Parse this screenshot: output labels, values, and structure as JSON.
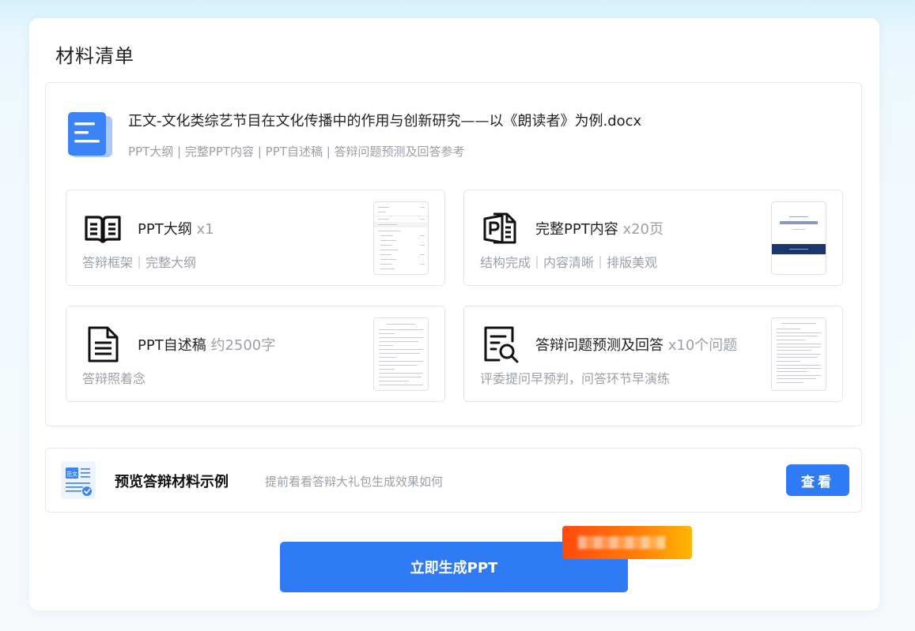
{
  "card": {
    "title": "材料清单"
  },
  "document": {
    "icon": "document-icon",
    "filename": "正文-文化类综艺节目在文化传播中的作用与创新研究——以《朗读者》为例.docx",
    "subtitle": "PPT大纲 | 完整PPT内容 | PPT自述稿 | 答辩问题预测及回答参考"
  },
  "items": [
    {
      "icon": "open-book-icon",
      "title": "PPT大纲",
      "count": "x1",
      "desc": "答辩框架｜完整大纲"
    },
    {
      "icon": "ppt-file-icon",
      "title": "完整PPT内容",
      "count": "x20页",
      "desc": "结构完成｜内容清晰｜排版美观"
    },
    {
      "icon": "text-file-icon",
      "title": "PPT自述稿",
      "count": "约2500字",
      "desc": "答辩照着念"
    },
    {
      "icon": "search-document-icon",
      "title": "答辩问题预测及回答",
      "count": "x10个问题",
      "desc": "评委提问早预判，问答环节早演练"
    }
  ],
  "preview": {
    "icon": "sample-document-icon",
    "icon_label": "范文",
    "title": "预览答辩材料示例",
    "subtitle": "提前看看答辩大礼包生成效果如何",
    "button": "查看"
  },
  "generate_button": "立即生成PPT",
  "colors": {
    "accent": "#2f7bf6",
    "promo_start": "#ff4a0e",
    "promo_end": "#ffb606"
  }
}
